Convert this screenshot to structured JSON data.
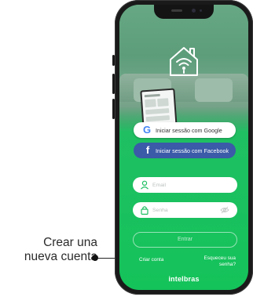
{
  "annotation": {
    "callout_line1": "Crear una",
    "callout_line2": "nueva cuenta"
  },
  "app": {
    "brand": "intelbras",
    "hero_icon": "smart-home-wifi-icon",
    "login_google_label": "Iniciar sessão com Google",
    "login_facebook_label": "Iniciar sessão com Facebook",
    "email_placeholder": "Email",
    "password_placeholder": "Senha",
    "submit_label": "Entrar",
    "create_account_label": "Criar conta",
    "forgot_password_label": "Esqueceu sua senha?",
    "colors": {
      "accent": "#1fbf62",
      "facebook": "#3b5aa8",
      "google_blue": "#4285f4"
    }
  }
}
